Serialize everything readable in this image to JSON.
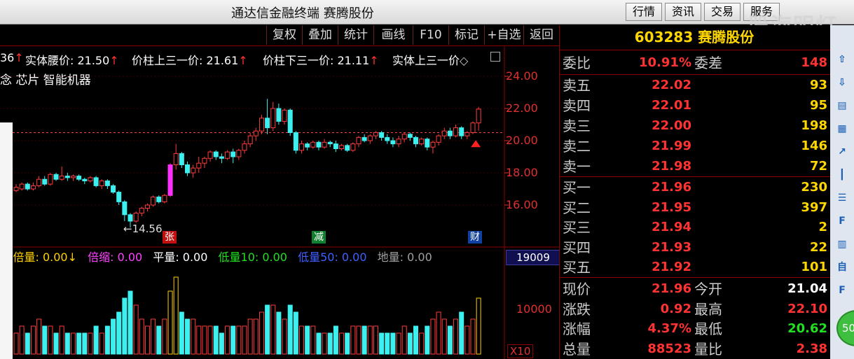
{
  "app": {
    "title": "通达信金融终端 赛腾股份",
    "menu": [
      "行情",
      "资讯",
      "交易",
      "服务"
    ],
    "watermark": "股海明灯"
  },
  "toolbar": [
    "复权",
    "叠加",
    "统计",
    "画线",
    "F10",
    "标记",
    "+自选",
    "返回"
  ],
  "indicators": {
    "lead": "36",
    "body_mid": "实体腰价: 21.50",
    "bar_upper3": "价柱上三一价: 21.61",
    "bar_lower3": "价柱下三一价: 21.11",
    "body_upper3": "实体上三一价",
    "concept": "念 芯片 智能机器",
    "low_label": "←14.56",
    "badges": [
      "张",
      "减",
      "财"
    ]
  },
  "price_axis": [
    "24.00",
    "22.00",
    "20.00",
    "18.00",
    "16.00"
  ],
  "volume": {
    "items": [
      {
        "label": "倍量: 0.00",
        "arrow": "↓",
        "color": "#ffd000"
      },
      {
        "label": "倍缩: 0.00",
        "arrow": "",
        "color": "#ff40ff"
      },
      {
        "label": "平量: 0.00",
        "arrow": "",
        "color": "#ffffff"
      },
      {
        "label": "低量10: 0.00",
        "arrow": "",
        "color": "#20e020"
      },
      {
        "label": "低量50: 0.00",
        "arrow": "",
        "color": "#4060ff"
      },
      {
        "label": "地量: 0.00",
        "arrow": "",
        "color": "#a0a0a0"
      }
    ],
    "box": "19009",
    "axis_10000": "10000",
    "axis_x10": "X10"
  },
  "quote": {
    "code": "603283 赛腾股份",
    "weibi": {
      "label": "委比",
      "value": "10.91%",
      "label2": "委差",
      "value2": "148"
    },
    "sell": [
      {
        "label": "卖五",
        "price": "22.02",
        "vol": "93"
      },
      {
        "label": "卖四",
        "price": "22.01",
        "vol": "95"
      },
      {
        "label": "卖三",
        "price": "22.00",
        "vol": "198"
      },
      {
        "label": "卖二",
        "price": "21.99",
        "vol": "146"
      },
      {
        "label": "卖一",
        "price": "21.98",
        "vol": "72"
      }
    ],
    "buy": [
      {
        "label": "买一",
        "price": "21.96",
        "vol": "230"
      },
      {
        "label": "买二",
        "price": "21.95",
        "vol": "397"
      },
      {
        "label": "买三",
        "price": "21.94",
        "vol": "2"
      },
      {
        "label": "买四",
        "price": "21.93",
        "vol": "22"
      },
      {
        "label": "买五",
        "price": "21.92",
        "vol": "101"
      }
    ],
    "stats": [
      {
        "l1": "现价",
        "v1": "21.96",
        "l2": "今开",
        "v2": "21.04",
        "c2": "#ffffff"
      },
      {
        "l1": "涨跌",
        "v1": "0.92",
        "l2": "最高",
        "v2": "22.10",
        "c2": "#ff3333"
      },
      {
        "l1": "涨幅",
        "v1": "4.37%",
        "l2": "最低",
        "v2": "20.62",
        "c2": "#20e020"
      },
      {
        "l1": "总量",
        "v1": "88523",
        "l2": "量比",
        "v2": "2.38",
        "c2": "#ff3333"
      }
    ]
  },
  "side_icons": [
    "up-arrow-icon",
    "down-arrow-icon",
    "report-icon",
    "grid-icon",
    "trend-icon",
    "candle-icon",
    "list-icon",
    "f10-icon",
    "tree-icon",
    "self-icon",
    "f12-icon"
  ],
  "circle_badge": "50",
  "chart_data": {
    "type": "candlestick",
    "ylim": [
      14,
      25
    ],
    "candles": [
      [
        16.9,
        17.1,
        16.8,
        17.3
      ],
      [
        17.0,
        17.3,
        16.9,
        17.4
      ],
      [
        17.3,
        17.0,
        16.9,
        17.4
      ],
      [
        17.0,
        17.2,
        16.9,
        17.4
      ],
      [
        17.2,
        17.6,
        17.1,
        17.8
      ],
      [
        17.6,
        17.3,
        17.2,
        17.8
      ],
      [
        17.3,
        17.9,
        17.2,
        18.0
      ],
      [
        17.9,
        17.6,
        17.5,
        18.0
      ],
      [
        17.6,
        17.8,
        17.5,
        18.4
      ],
      [
        17.8,
        17.7,
        17.5,
        18.0
      ],
      [
        17.7,
        17.8,
        17.5,
        17.9
      ],
      [
        17.8,
        17.6,
        17.5,
        17.9
      ],
      [
        17.6,
        17.5,
        17.3,
        17.7
      ],
      [
        17.5,
        17.7,
        17.4,
        17.8
      ],
      [
        17.7,
        17.2,
        17.1,
        17.8
      ],
      [
        17.2,
        17.5,
        17.0,
        17.6
      ],
      [
        17.5,
        17.2,
        17.0,
        17.6
      ],
      [
        17.2,
        16.8,
        16.7,
        17.3
      ],
      [
        16.8,
        16.2,
        16.0,
        16.9
      ],
      [
        16.2,
        15.4,
        15.0,
        16.3
      ],
      [
        15.4,
        15.0,
        14.6,
        15.5
      ],
      [
        15.0,
        15.5,
        14.9,
        15.6
      ],
      [
        15.5,
        15.8,
        15.3,
        15.9
      ],
      [
        15.8,
        16.0,
        15.6,
        16.1
      ],
      [
        16.0,
        16.5,
        15.9,
        16.6
      ],
      [
        16.5,
        16.2,
        16.1,
        16.6
      ],
      [
        16.2,
        16.6,
        16.1,
        16.7
      ],
      [
        16.6,
        18.5,
        16.5,
        18.6
      ],
      [
        18.5,
        19.2,
        18.2,
        19.8
      ],
      [
        19.2,
        18.5,
        18.3,
        19.3
      ],
      [
        18.5,
        18.0,
        17.8,
        18.7
      ],
      [
        18.0,
        18.3,
        17.7,
        18.5
      ],
      [
        18.3,
        18.6,
        18.0,
        19.0
      ],
      [
        18.6,
        18.9,
        18.3,
        19.0
      ],
      [
        18.9,
        19.3,
        18.7,
        19.4
      ],
      [
        19.3,
        19.0,
        18.8,
        19.4
      ],
      [
        19.0,
        18.9,
        18.6,
        19.2
      ],
      [
        18.9,
        19.3,
        18.8,
        19.4
      ],
      [
        19.3,
        19.0,
        18.6,
        19.5
      ],
      [
        19.0,
        19.4,
        18.8,
        19.5
      ],
      [
        19.4,
        19.8,
        19.2,
        20.0
      ],
      [
        19.8,
        20.3,
        19.6,
        20.5
      ],
      [
        20.3,
        20.6,
        20.0,
        20.8
      ],
      [
        20.6,
        21.4,
        20.4,
        21.6
      ],
      [
        21.4,
        20.8,
        20.4,
        22.6
      ],
      [
        20.8,
        22.0,
        20.6,
        22.4
      ],
      [
        22.0,
        21.2,
        21.0,
        22.3
      ],
      [
        21.2,
        21.9,
        21.0,
        22.0
      ],
      [
        21.9,
        20.5,
        20.3,
        22.0
      ],
      [
        20.5,
        19.4,
        19.2,
        20.6
      ],
      [
        19.4,
        19.8,
        19.2,
        20.0
      ],
      [
        19.8,
        19.6,
        19.4,
        19.9
      ],
      [
        19.6,
        19.9,
        19.5,
        20.0
      ],
      [
        19.9,
        19.6,
        19.4,
        20.0
      ],
      [
        19.6,
        19.9,
        19.5,
        20.1
      ],
      [
        19.9,
        19.8,
        19.6,
        20.0
      ],
      [
        19.8,
        19.5,
        19.3,
        20.0
      ],
      [
        19.5,
        19.7,
        19.4,
        19.8
      ],
      [
        19.7,
        19.4,
        19.3,
        19.8
      ],
      [
        19.4,
        19.8,
        19.3,
        19.9
      ],
      [
        19.8,
        20.2,
        19.6,
        20.3
      ],
      [
        20.2,
        20.0,
        19.9,
        20.4
      ],
      [
        20.0,
        20.3,
        19.8,
        20.4
      ],
      [
        20.3,
        20.5,
        20.1,
        20.6
      ],
      [
        20.5,
        20.2,
        20.0,
        20.6
      ],
      [
        20.2,
        20.0,
        19.8,
        20.4
      ],
      [
        20.0,
        19.8,
        19.6,
        20.2
      ],
      [
        19.8,
        20.1,
        19.6,
        20.3
      ],
      [
        20.1,
        20.4,
        19.9,
        20.5
      ],
      [
        20.4,
        20.2,
        20.0,
        20.5
      ],
      [
        20.2,
        19.8,
        19.6,
        20.3
      ],
      [
        19.8,
        20.1,
        19.7,
        20.2
      ],
      [
        20.1,
        19.6,
        19.4,
        20.2
      ],
      [
        19.6,
        19.9,
        19.2,
        20.0
      ],
      [
        19.9,
        20.3,
        19.7,
        20.4
      ],
      [
        20.3,
        20.6,
        20.1,
        20.8
      ],
      [
        20.6,
        20.3,
        20.1,
        20.8
      ],
      [
        20.3,
        20.8,
        20.2,
        21.0
      ],
      [
        20.8,
        20.3,
        20.1,
        20.9
      ],
      [
        20.3,
        20.5,
        20.1,
        20.6
      ],
      [
        20.5,
        21.1,
        20.4,
        21.2
      ],
      [
        21.1,
        21.96,
        20.62,
        22.1
      ]
    ],
    "volumes": [
      3,
      4,
      3,
      4,
      5,
      4,
      4,
      3,
      4,
      3,
      3,
      3,
      3,
      3,
      4,
      3,
      4,
      5,
      6,
      8,
      9,
      7,
      5,
      4,
      5,
      4,
      5,
      9,
      11,
      6,
      5,
      5,
      4,
      4,
      4,
      4,
      3,
      4,
      4,
      4,
      4,
      5,
      5,
      6,
      7,
      7,
      6,
      5,
      7,
      6,
      4,
      4,
      4,
      3,
      3,
      3,
      4,
      3,
      3,
      4,
      4,
      4,
      4,
      4,
      3,
      3,
      3,
      3,
      4,
      3,
      4,
      3,
      4,
      5,
      6,
      5,
      4,
      5,
      6,
      4,
      5,
      8
    ]
  }
}
